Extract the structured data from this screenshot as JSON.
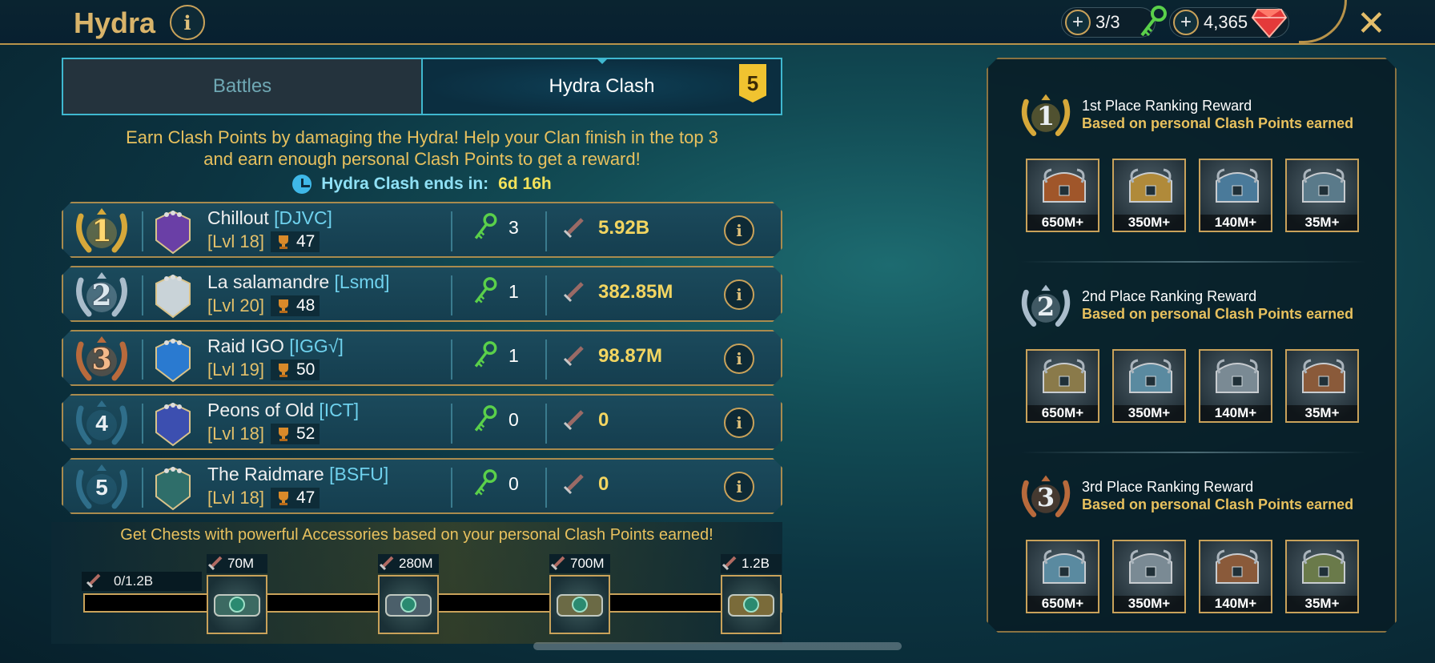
{
  "header": {
    "title": "Hydra",
    "info_icon": "i",
    "keys": "3/3",
    "gems": "4,365",
    "close": "✕"
  },
  "tabs": [
    {
      "label": "Battles",
      "active": false
    },
    {
      "label": "Hydra Clash",
      "active": true,
      "badge": "5"
    }
  ],
  "description": {
    "line1": "Earn Clash Points by damaging the Hydra! Help your Clan finish in the top 3",
    "line2": "and earn enough personal Clash Points to get a reward!"
  },
  "timer": {
    "label": "Hydra Clash ends in:",
    "value": "6d 16h"
  },
  "clans": [
    {
      "rank": "1",
      "name": "Chillout",
      "tag": "[DJVC]",
      "level": "[Lvl 18]",
      "trophies": "47",
      "keys": "3",
      "damage": "5.92B",
      "info": "i"
    },
    {
      "rank": "2",
      "name": "La salamandre",
      "tag": "[Lsmd]",
      "level": "[Lvl 20]",
      "trophies": "48",
      "keys": "1",
      "damage": "382.85M",
      "info": "i"
    },
    {
      "rank": "3",
      "name": "Raid IGO",
      "tag": "[IGG√]",
      "level": "[Lvl 19]",
      "trophies": "50",
      "keys": "1",
      "damage": "98.87M",
      "info": "i"
    },
    {
      "rank": "4",
      "name": "Peons of Old",
      "tag": "[ICT]",
      "level": "[Lvl 18]",
      "trophies": "52",
      "keys": "0",
      "damage": "0",
      "info": "i"
    },
    {
      "rank": "5",
      "name": "The Raidmare",
      "tag": "[BSFU]",
      "level": "[Lvl 18]",
      "trophies": "47",
      "keys": "0",
      "damage": "0",
      "info": "i"
    }
  ],
  "progress": {
    "title": "Get Chests with powerful Accessories based on your personal Clash Points earned!",
    "current": "0/1.2B",
    "fill": 0,
    "milestones": [
      "70M",
      "280M",
      "700M",
      "1.2B"
    ]
  },
  "rewards": [
    {
      "rank": "1",
      "title": "1st Place Ranking Reward",
      "subtitle": "Based on personal Clash Points earned",
      "chests": [
        "650M+",
        "350M+",
        "140M+",
        "35M+"
      ]
    },
    {
      "rank": "2",
      "title": "2nd Place Ranking Reward",
      "subtitle": "Based on personal Clash Points earned",
      "chests": [
        "650M+",
        "350M+",
        "140M+",
        "35M+"
      ]
    },
    {
      "rank": "3",
      "title": "3rd Place Ranking Reward",
      "subtitle": "Based on personal Clash Points earned",
      "chests": [
        "650M+",
        "350M+",
        "140M+",
        "35M+"
      ]
    }
  ],
  "colors": {
    "gold": "#e8c15e",
    "cyan": "#3fb8d0",
    "tag": "#6fd2ee",
    "damage": "#f2d561"
  }
}
